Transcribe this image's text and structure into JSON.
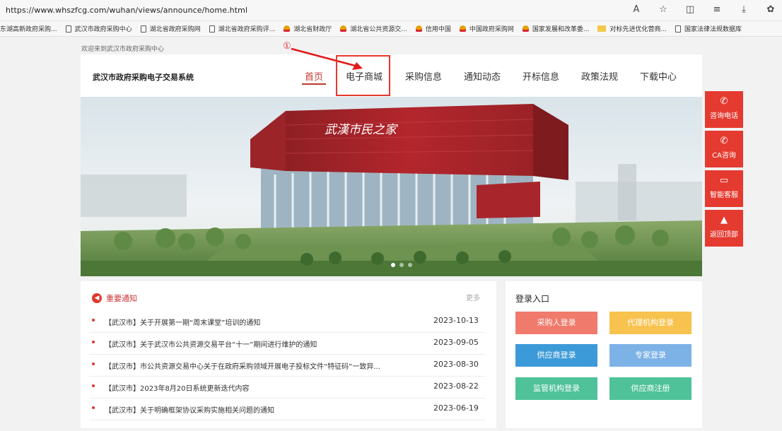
{
  "browser": {
    "url": "https://www.whszfcg.com/wuhan/views/announce/home.html",
    "bookmarks": [
      {
        "label": "东湖高新政府采购...",
        "icon": "none"
      },
      {
        "label": "武汉市政府采购中心",
        "icon": "page-icon"
      },
      {
        "label": "湖北省政府采购网",
        "icon": "page-icon"
      },
      {
        "label": "湖北省政府采购评...",
        "icon": "page-icon"
      },
      {
        "label": "湖北省财政厅",
        "icon": "gov-emblem-icon"
      },
      {
        "label": "湖北省公共资源交...",
        "icon": "gov-emblem-icon"
      },
      {
        "label": "信用中国",
        "icon": "gov-emblem-icon"
      },
      {
        "label": "中国政府采购网",
        "icon": "gov-emblem-icon"
      },
      {
        "label": "国家发展和改革委...",
        "icon": "gov-emblem-icon"
      },
      {
        "label": "对标先进优化营商...",
        "icon": "folder-icon"
      },
      {
        "label": "国家法律法规数据库",
        "icon": "page-icon"
      }
    ]
  },
  "header": {
    "welcome": "欢迎来到武汉市政府采购中心",
    "site_title": "武汉市政府采购电子交易系统",
    "nav": [
      "首页",
      "电子商城",
      "采购信息",
      "通知动态",
      "开标信息",
      "政策法规",
      "下载中心"
    ],
    "active_nav": "首页"
  },
  "annotation": {
    "number": "①"
  },
  "banner": {
    "building_sign": "武漢市民之家",
    "slides": 3,
    "active_slide": 1
  },
  "side_float": [
    "咨询电话",
    "CA咨询",
    "智能客服",
    "返回顶部"
  ],
  "notice": {
    "title": "重要通知",
    "more": "更多",
    "items": [
      {
        "text": "【武汉市】关于开展第一期“周末课堂”培训的通知",
        "date": "2023-10-13"
      },
      {
        "text": "【武汉市】关于武汉市公共资源交易平台“十一”期间进行维护的通知",
        "date": "2023-09-05"
      },
      {
        "text": "【武汉市】市公共资源交易中心关于在政府采购领域开展电子投标文件“特征码”一致异...",
        "date": "2023-08-30"
      },
      {
        "text": "【武汉市】2023年8月20日系统更新迭代内容",
        "date": "2023-08-22"
      },
      {
        "text": "【武汉市】关于明确框架协议采购实施相关问题的通知",
        "date": "2023-06-19"
      }
    ]
  },
  "login": {
    "title": "登录入口",
    "buttons": [
      "采购人登录",
      "代理机构登录",
      "供应商登录",
      "专家登录",
      "监管机构登录",
      "供应商注册"
    ]
  }
}
